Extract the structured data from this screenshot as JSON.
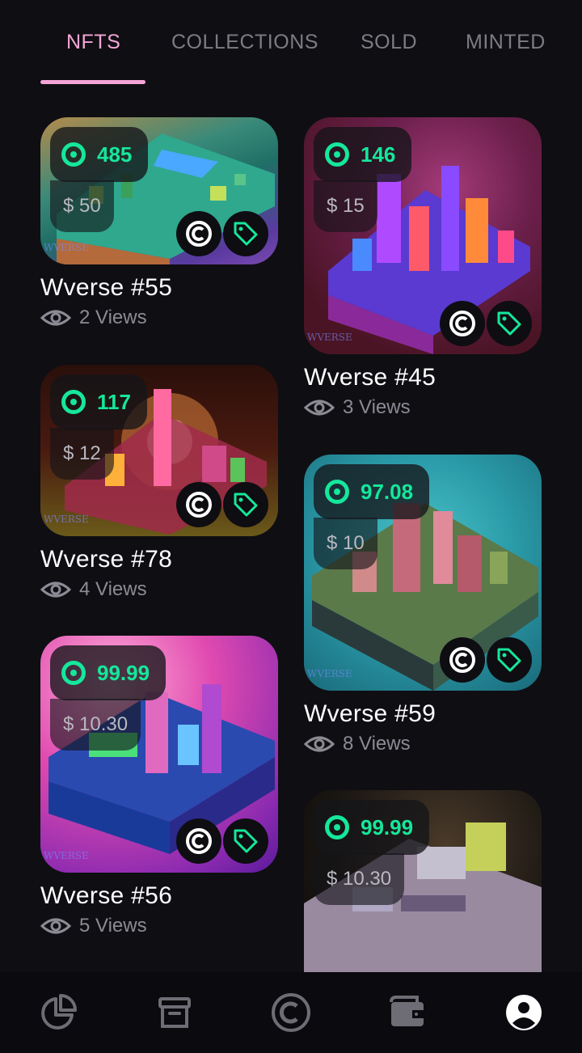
{
  "tabs": [
    {
      "label": "NFTS",
      "active": true
    },
    {
      "label": "COLLECTIONS",
      "active": false
    },
    {
      "label": "SOLD",
      "active": false
    },
    {
      "label": "MINTED",
      "active": false
    }
  ],
  "colors": {
    "accent_pink": "#f4a5d6",
    "coin_green": "#15e79b",
    "background": "#0f0e13"
  },
  "nfts": [
    {
      "name": "Wverse #55",
      "coin_price": "485",
      "usd_price": "$ 50",
      "views": "2 Views"
    },
    {
      "name": "Wverse #45",
      "coin_price": "146",
      "usd_price": "$ 15",
      "views": "3 Views"
    },
    {
      "name": "Wverse #78",
      "coin_price": "117",
      "usd_price": "$ 12",
      "views": "4 Views"
    },
    {
      "name": "Wverse #59",
      "coin_price": "97.08",
      "usd_price": "$ 10",
      "views": "8 Views"
    },
    {
      "name": "Wverse #56",
      "coin_price": "99.99",
      "usd_price": "$ 10.30",
      "views": "5 Views"
    },
    {
      "name": "",
      "coin_price": "99.99",
      "usd_price": "$ 10.30",
      "views": ""
    }
  ],
  "watermark": "WVERSE",
  "bottom_nav": [
    {
      "icon": "pie-chart-icon"
    },
    {
      "icon": "archive-box-icon"
    },
    {
      "icon": "coin-icon"
    },
    {
      "icon": "wallet-icon"
    },
    {
      "icon": "profile-icon",
      "active": true
    }
  ]
}
